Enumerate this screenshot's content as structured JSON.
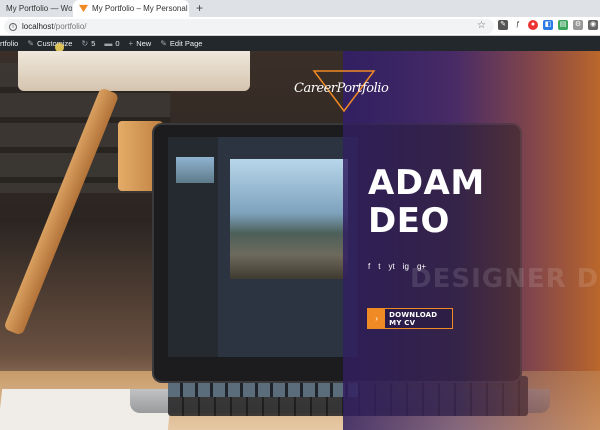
{
  "browser": {
    "tabs": [
      {
        "label": "My Portfolio — Wo"
      },
      {
        "label": "My Portfolio – My Personal Portf"
      }
    ],
    "new_tab_glyph": "+",
    "close_glyph": "✕",
    "url_host": "localhost",
    "url_path": "/portfolio/"
  },
  "wp_admin_bar": {
    "site_label": "rtfolio",
    "customize_label": "Customize",
    "updates_count": "5",
    "comments_count": "0",
    "new_label": "New",
    "edit_label": "Edit Page"
  },
  "hero": {
    "logo_text": "CareerPortfolio",
    "name_first": "ADAM",
    "name_last": "DEO",
    "socials": [
      "f",
      "t",
      "yt",
      "ig",
      "g+"
    ],
    "ghost_text": "DESIGNER DEVELO",
    "cta_label": "DOWNLOAD MY CV",
    "cta_arrow": "›"
  },
  "colors": {
    "accent": "#f08a24",
    "overlay": "#301e60",
    "wp_bar": "#23282d"
  }
}
